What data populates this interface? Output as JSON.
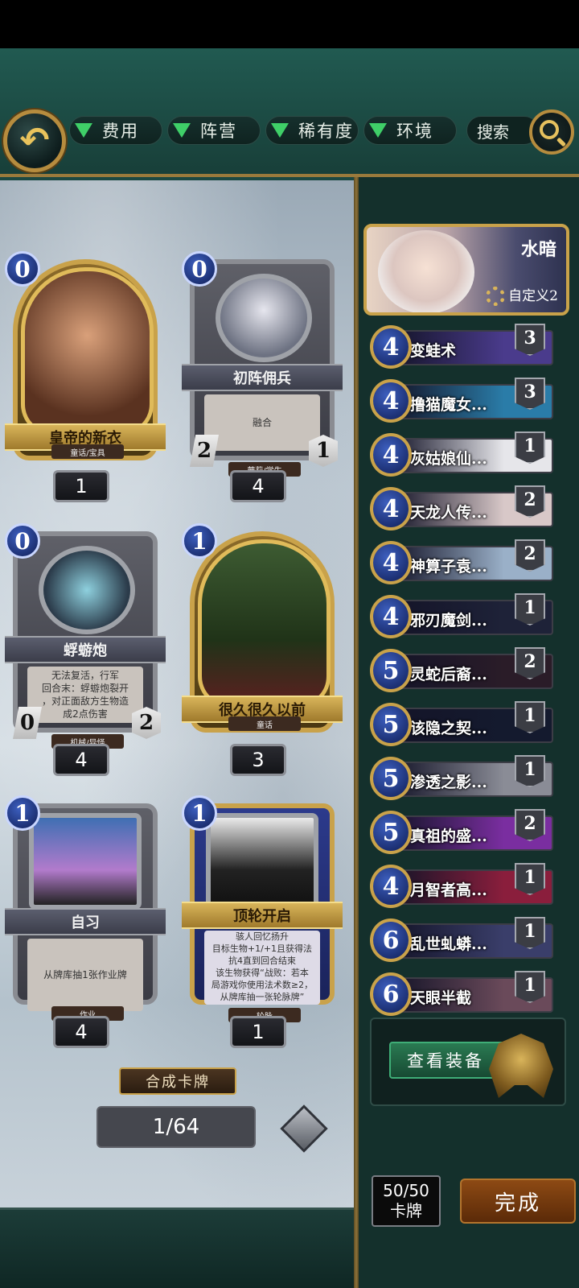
{
  "filters": {
    "cost": "费用",
    "faction": "阵营",
    "rarity": "稀有度",
    "environment": "环境",
    "search": "搜索"
  },
  "cards": [
    {
      "cost": "0",
      "name": "皇帝的新衣",
      "tag": "童话/宝具",
      "count": "1"
    },
    {
      "cost": "0",
      "name": "初阵佣兵",
      "text": "融合",
      "attack": "2",
      "health": "1",
      "tag": "萝莉/学生",
      "count": "4"
    },
    {
      "cost": "0",
      "name": "蜉蝣炮",
      "text": "无法复活，行军\n回合末：蜉蝣炮裂开\n，对正面敌方生物造\n成2点伤害",
      "attack": "0",
      "health": "2",
      "tag": "机械/异怪",
      "count": "4"
    },
    {
      "cost": "1",
      "name": "很久很久以前",
      "tag": "童话",
      "count": "3"
    },
    {
      "cost": "1",
      "name": "自习",
      "text": "从牌库抽1张作业牌",
      "tag": "作业",
      "count": "4"
    },
    {
      "cost": "1",
      "name": "顶轮开启",
      "text": "骇人回忆扬升\n目标生物+1/+1且获得法\n抗4直到回合结束\n该生物获得“战败：若本\n局游戏你使用法术数≥2，\n从牌库抽一张轮脉牌”",
      "tag": "轮脉",
      "count": "1"
    }
  ],
  "synthesize": "合成卡牌",
  "page": "1/64",
  "hero": {
    "name": "水暗",
    "deck_name": "自定义2"
  },
  "deck": [
    {
      "cost": "4",
      "name": "变蛙术",
      "qty": "3",
      "color": "#4a3b8c"
    },
    {
      "cost": "4",
      "name": "撸猫魔女...",
      "qty": "3",
      "color": "#2a7ca8"
    },
    {
      "cost": "4",
      "name": "灰姑娘仙...",
      "qty": "1",
      "color": "#e6e6ea"
    },
    {
      "cost": "4",
      "name": "天龙人传...",
      "qty": "2",
      "color": "#d8c8c8"
    },
    {
      "cost": "4",
      "name": "神算子袁...",
      "qty": "2",
      "color": "#9ab0c8"
    },
    {
      "cost": "4",
      "name": "邪刃魔剑...",
      "qty": "1",
      "color": "#1e2238"
    },
    {
      "cost": "5",
      "name": "灵蛇后裔...",
      "qty": "2",
      "color": "#2a1c28"
    },
    {
      "cost": "5",
      "name": "该隐之契...",
      "qty": "1",
      "color": "#141a2e"
    },
    {
      "cost": "5",
      "name": "渗透之影...",
      "qty": "1",
      "color": "#8a8c96"
    },
    {
      "cost": "5",
      "name": "真祖的盛...",
      "qty": "2",
      "color": "#7a2ea0"
    },
    {
      "cost": "4",
      "name": "月智者高...",
      "qty": "1",
      "color": "#8a1e3c"
    },
    {
      "cost": "6",
      "name": "乱世虬蟒...",
      "qty": "1",
      "color": "#3a3e6a"
    },
    {
      "cost": "6",
      "name": "天眼半截",
      "qty": "1",
      "color": "#6a4a5a"
    }
  ],
  "equip_button": "查看装备",
  "deck_count": {
    "value": "50/50",
    "label": "卡牌"
  },
  "done_button": "完成"
}
